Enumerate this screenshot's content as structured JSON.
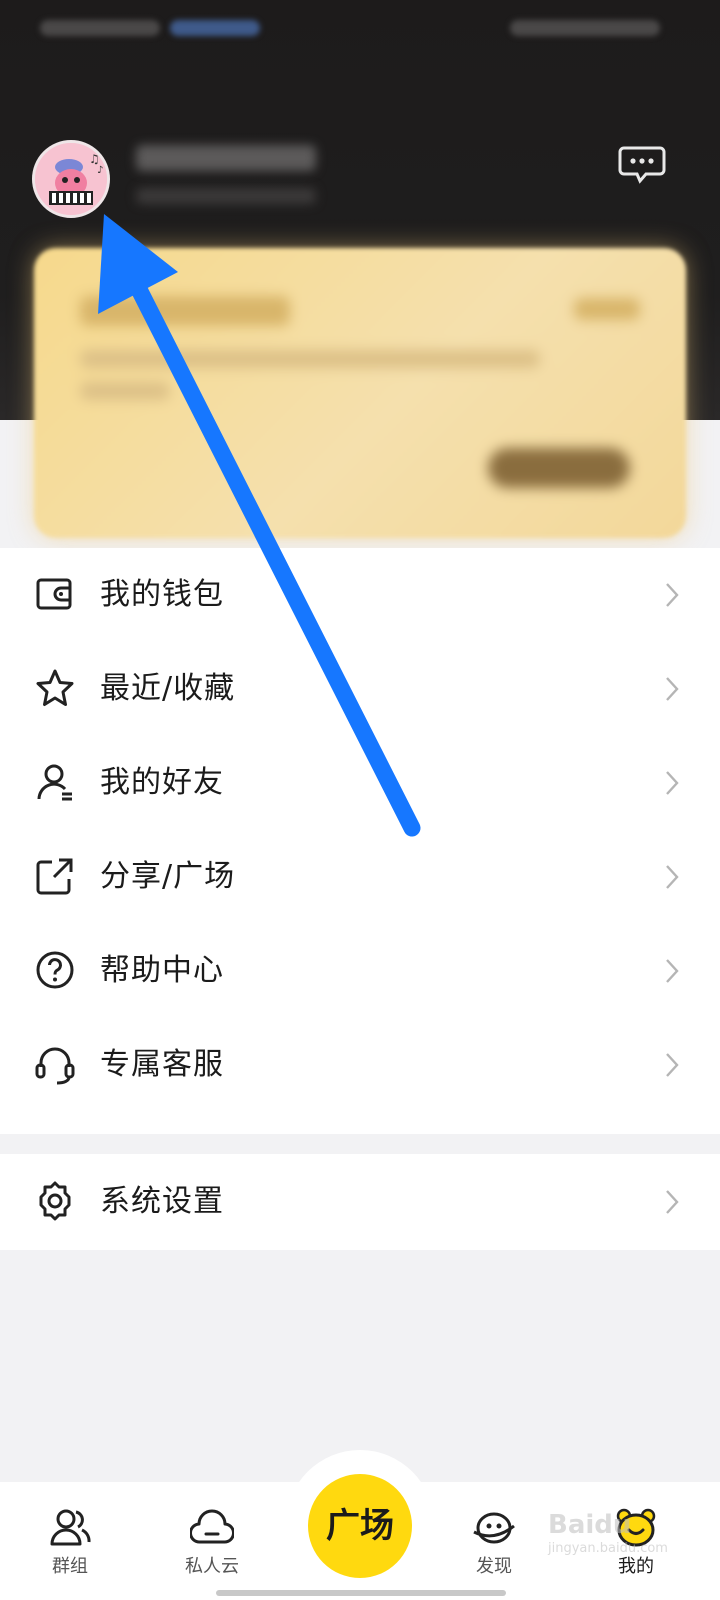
{
  "menu": {
    "items": [
      {
        "label": "我的钱包",
        "icon": "wallet-icon"
      },
      {
        "label": "最近/收藏",
        "icon": "star-icon"
      },
      {
        "label": "我的好友",
        "icon": "person-icon"
      },
      {
        "label": "分享/广场",
        "icon": "share-icon"
      },
      {
        "label": "帮助中心",
        "icon": "question-icon"
      },
      {
        "label": "专属客服",
        "icon": "headset-icon"
      }
    ],
    "settings_label": "系统设置"
  },
  "tabbar": {
    "tabs": [
      {
        "label": "群组",
        "icon": "group-icon"
      },
      {
        "label": "私人云",
        "icon": "cloud-icon"
      },
      {
        "label": "广场",
        "icon": "square-center-button"
      },
      {
        "label": "发现",
        "icon": "discover-icon"
      },
      {
        "label": "我的",
        "icon": "mine-icon"
      }
    ]
  },
  "watermark": {
    "brand": "Baidu",
    "sub": "jingyan.baidu.com"
  },
  "colors": {
    "header_bg": "#1d1b1b",
    "accent_yellow": "#ffd90f",
    "annotation_arrow": "#1677ff",
    "banner_gold": "#f6d98c"
  }
}
